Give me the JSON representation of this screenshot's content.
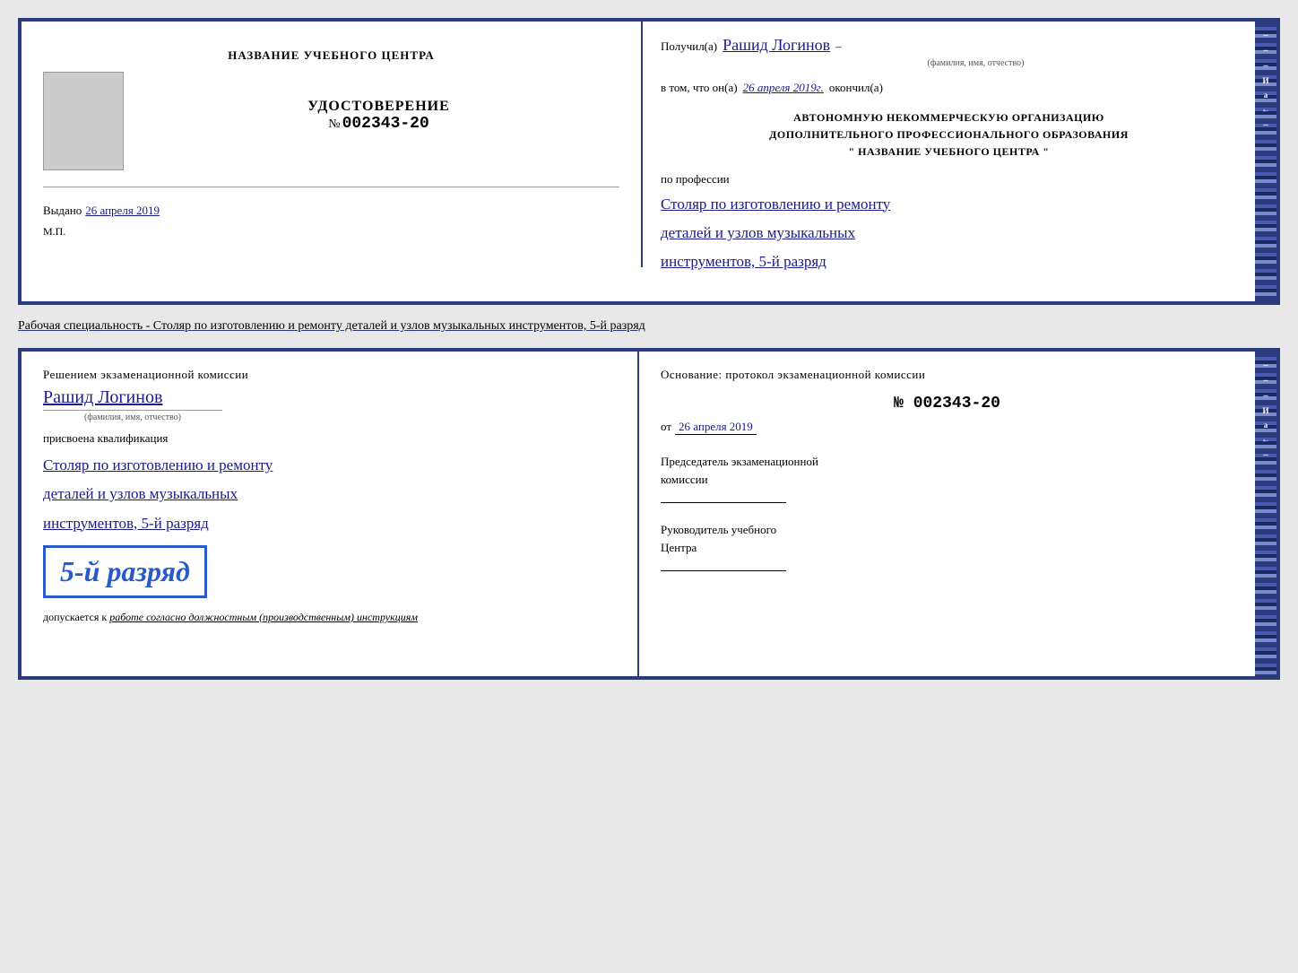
{
  "top": {
    "left": {
      "school_name": "НАЗВАНИЕ УЧЕБНОГО ЦЕНТРА",
      "udostoverenie": "УДОСТОВЕРЕНИЕ",
      "number_prefix": "№",
      "number": "002343-20",
      "vydano_label": "Выдано",
      "vydano_date": "26 апреля 2019",
      "mp": "М.П."
    },
    "right": {
      "poluchil_label": "Получил(а)",
      "poluchil_name": "Рашид Логинов",
      "dash": "–",
      "fio_label": "(фамилия, имя, отчество)",
      "vtom_label": "в том, что он(а)",
      "vtom_date": "26 апреля 2019г.",
      "okonchil": "окончил(а)",
      "org_line1": "АВТОНОМНУЮ НЕКОММЕРЧЕСКУЮ ОРГАНИЗАЦИЮ",
      "org_line2": "ДОПОЛНИТЕЛЬНОГО ПРОФЕССИОНАЛЬНОГО ОБРАЗОВАНИЯ",
      "org_line3": "\"  НАЗВАНИЕ УЧЕБНОГО ЦЕНТРА  \"",
      "po_professii": "по профессии",
      "profession_line1": "Столяр по изготовлению и ремонту",
      "profession_line2": "деталей и узлов музыкальных",
      "profession_line3": "инструментов, 5-й разряд"
    }
  },
  "specialty_label": "Рабочая специальность - Столяр по изготовлению и ремонту деталей и узлов музыкальных инструментов, 5-й разряд",
  "bottom": {
    "left": {
      "resheniem": "Решением экзаменационной комиссии",
      "name": "Рашид Логинов",
      "fio_label": "(фамилия, имя, отчество)",
      "prisvoena": "присвоена квалификация",
      "qual_line1": "Столяр по изготовлению и ремонту",
      "qual_line2": "деталей и узлов музыкальных",
      "qual_line3": "инструментов, 5-й разряд",
      "razryad_big": "5-й разряд",
      "dopusk_label": "допускается к",
      "dopusk_value": "работе согласно должностным (производственным) инструкциям"
    },
    "right": {
      "osnovanie": "Основание: протокол экзаменационной комиссии",
      "number_prefix": "№",
      "number": "002343-20",
      "ot_label": "от",
      "ot_date": "26 апреля 2019",
      "predsedatel_line1": "Председатель экзаменационной",
      "predsedatel_line2": "комиссии",
      "rukovoditel_line1": "Руководитель учебного",
      "rukovoditel_line2": "Центра"
    }
  },
  "edge_labels": {
    "right_top": [
      "и",
      "а",
      "←",
      "–",
      "–",
      "–",
      "–"
    ],
    "right_bottom": [
      "и",
      "а",
      "←",
      "–",
      "–",
      "–",
      "–"
    ]
  }
}
